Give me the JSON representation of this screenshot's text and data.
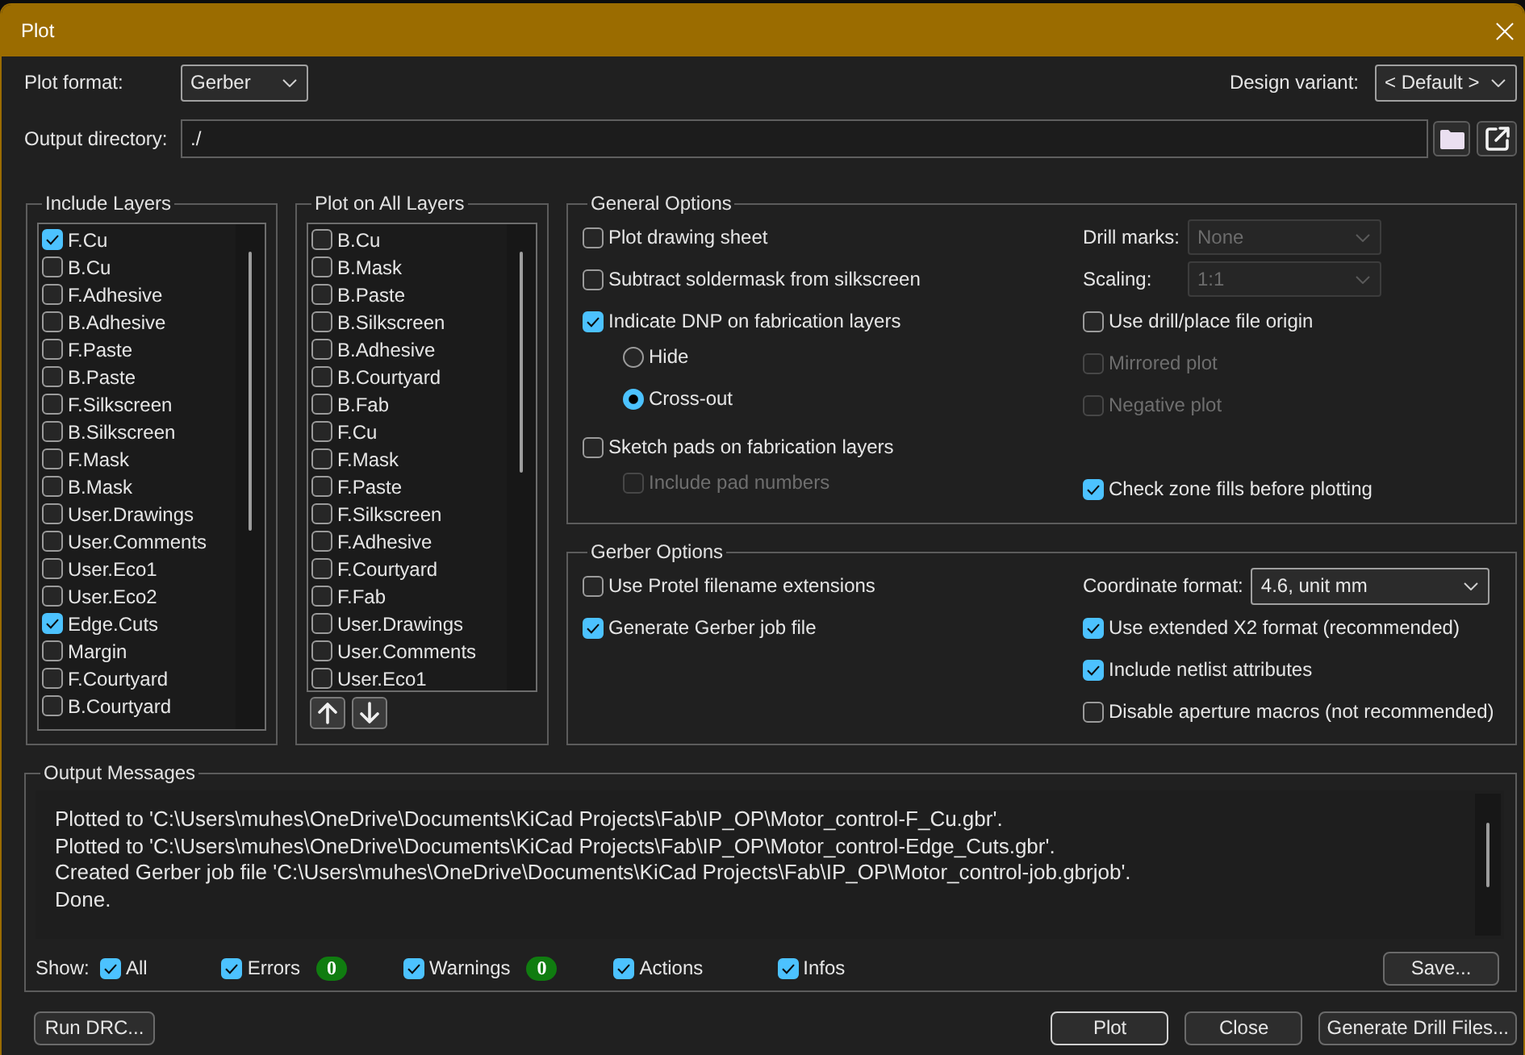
{
  "window": {
    "title": "Plot"
  },
  "plot_format": {
    "label": "Plot format:",
    "value": "Gerber"
  },
  "design_variant": {
    "label": "Design variant:",
    "value": "< Default >"
  },
  "output_directory": {
    "label": "Output directory:",
    "value": "./"
  },
  "include_layers": {
    "title": "Include Layers",
    "items": [
      {
        "label": "F.Cu",
        "checked": true
      },
      {
        "label": "B.Cu",
        "checked": false
      },
      {
        "label": "F.Adhesive",
        "checked": false
      },
      {
        "label": "B.Adhesive",
        "checked": false
      },
      {
        "label": "F.Paste",
        "checked": false
      },
      {
        "label": "B.Paste",
        "checked": false
      },
      {
        "label": "F.Silkscreen",
        "checked": false
      },
      {
        "label": "B.Silkscreen",
        "checked": false
      },
      {
        "label": "F.Mask",
        "checked": false
      },
      {
        "label": "B.Mask",
        "checked": false
      },
      {
        "label": "User.Drawings",
        "checked": false
      },
      {
        "label": "User.Comments",
        "checked": false
      },
      {
        "label": "User.Eco1",
        "checked": false
      },
      {
        "label": "User.Eco2",
        "checked": false
      },
      {
        "label": "Edge.Cuts",
        "checked": true
      },
      {
        "label": "Margin",
        "checked": false
      },
      {
        "label": "F.Courtyard",
        "checked": false
      },
      {
        "label": "B.Courtyard",
        "checked": false
      }
    ]
  },
  "plot_on_all_layers": {
    "title": "Plot on All Layers",
    "items": [
      {
        "label": "B.Cu",
        "checked": false
      },
      {
        "label": "B.Mask",
        "checked": false
      },
      {
        "label": "B.Paste",
        "checked": false
      },
      {
        "label": "B.Silkscreen",
        "checked": false
      },
      {
        "label": "B.Adhesive",
        "checked": false
      },
      {
        "label": "B.Courtyard",
        "checked": false
      },
      {
        "label": "B.Fab",
        "checked": false
      },
      {
        "label": "F.Cu",
        "checked": false
      },
      {
        "label": "F.Mask",
        "checked": false
      },
      {
        "label": "F.Paste",
        "checked": false
      },
      {
        "label": "F.Silkscreen",
        "checked": false
      },
      {
        "label": "F.Adhesive",
        "checked": false
      },
      {
        "label": "F.Courtyard",
        "checked": false
      },
      {
        "label": "F.Fab",
        "checked": false
      },
      {
        "label": "User.Drawings",
        "checked": false
      },
      {
        "label": "User.Comments",
        "checked": false
      },
      {
        "label": "User.Eco1",
        "checked": false
      }
    ]
  },
  "general_options": {
    "title": "General Options",
    "left": [
      {
        "kind": "checkbox",
        "label": "Plot drawing sheet",
        "checked": false,
        "disabled": false
      },
      {
        "kind": "checkbox",
        "label": "Subtract soldermask from silkscreen",
        "checked": false,
        "disabled": false
      },
      {
        "kind": "checkbox",
        "label": "Indicate DNP on fabrication layers",
        "checked": true,
        "disabled": false,
        "children": [
          {
            "kind": "radio",
            "label": "Hide",
            "selected": false,
            "disabled": false
          },
          {
            "kind": "radio",
            "label": "Cross-out",
            "selected": true,
            "disabled": false
          }
        ]
      },
      {
        "kind": "checkbox",
        "label": "Sketch pads on fabrication layers",
        "checked": false,
        "disabled": false,
        "children": [
          {
            "kind": "checkbox",
            "label": "Include pad numbers",
            "checked": false,
            "disabled": true
          }
        ]
      }
    ],
    "right": [
      {
        "kind": "select",
        "label": "Drill marks:",
        "value": "None",
        "disabled": true
      },
      {
        "kind": "select",
        "label": "Scaling:",
        "value": "1:1",
        "disabled": true
      },
      {
        "kind": "checkbox",
        "label": "Use drill/place file origin",
        "checked": false,
        "disabled": false
      },
      {
        "kind": "checkbox",
        "label": "Mirrored plot",
        "checked": false,
        "disabled": true
      },
      {
        "kind": "checkbox",
        "label": "Negative plot",
        "checked": false,
        "disabled": true
      },
      {
        "kind": "checkbox",
        "label": "Check zone fills before plotting",
        "checked": true,
        "disabled": false
      }
    ]
  },
  "gerber_options": {
    "title": "Gerber Options",
    "left": [
      {
        "kind": "checkbox",
        "label": "Use Protel filename extensions",
        "checked": false,
        "disabled": false
      },
      {
        "kind": "checkbox",
        "label": "Generate Gerber job file",
        "checked": true,
        "disabled": false
      }
    ],
    "right": [
      {
        "kind": "select",
        "label": "Coordinate format:",
        "value": "4.6, unit mm",
        "disabled": false
      },
      {
        "kind": "checkbox",
        "label": "Use extended X2 format (recommended)",
        "checked": true,
        "disabled": false
      },
      {
        "kind": "checkbox",
        "label": "Include netlist attributes",
        "checked": true,
        "disabled": false
      },
      {
        "kind": "checkbox",
        "label": "Disable aperture macros (not recommended)",
        "checked": false,
        "disabled": false
      }
    ]
  },
  "output_messages": {
    "title": "Output Messages",
    "lines": [
      "Plotted to 'C:\\Users\\muhes\\OneDrive\\Documents\\KiCad Projects\\Fab\\IP_OP\\Motor_control-F_Cu.gbr'.",
      "Plotted to 'C:\\Users\\muhes\\OneDrive\\Documents\\KiCad Projects\\Fab\\IP_OP\\Motor_control-Edge_Cuts.gbr'.",
      "Created Gerber job file 'C:\\Users\\muhes\\OneDrive\\Documents\\KiCad Projects\\Fab\\IP_OP\\Motor_control-job.gbrjob'.",
      "Done."
    ],
    "show_label": "Show:",
    "filters": [
      {
        "label": "All",
        "checked": true
      },
      {
        "label": "Errors",
        "checked": true,
        "count": "0"
      },
      {
        "label": "Warnings",
        "checked": true,
        "count": "0"
      },
      {
        "label": "Actions",
        "checked": true
      },
      {
        "label": "Infos",
        "checked": true
      }
    ],
    "save_button": "Save..."
  },
  "footer": {
    "left_buttons": [
      {
        "label": "Run DRC...",
        "default": false
      }
    ],
    "right_buttons": [
      {
        "label": "Plot",
        "default": true
      },
      {
        "label": "Close",
        "default": false
      },
      {
        "label": "Generate Drill Files...",
        "default": false
      }
    ]
  }
}
